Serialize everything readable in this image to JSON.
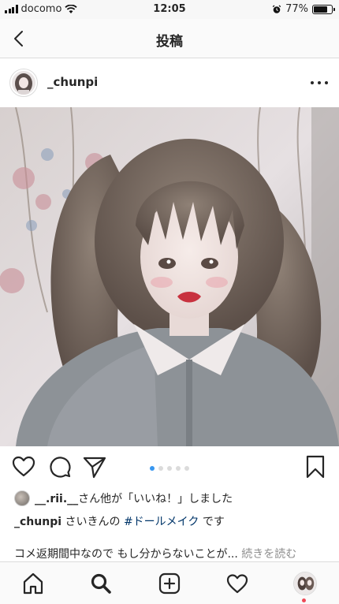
{
  "status_bar": {
    "carrier": "docomo",
    "time": "12:05",
    "battery_text": "77%",
    "battery_level": 0.77
  },
  "header": {
    "title": "投稿"
  },
  "post": {
    "username": "_chunpi",
    "carousel": {
      "count": 5,
      "active_index": 0
    },
    "likes": {
      "user": "__.rii.__",
      "suffix": "さん他が「いいね！」しました"
    },
    "caption": {
      "username": "_chunpi",
      "text_before": " さいきんの ",
      "hashtag": "#ドールメイク",
      "text_after": " です"
    },
    "comment_preview": {
      "text": "コメ返期間中なので もし分からないことが...",
      "more": "続きを読む"
    }
  },
  "tab_bar": {
    "items": [
      "home-icon",
      "search-icon",
      "add-icon",
      "heart-icon",
      "profile-avatar"
    ],
    "active": "search-icon"
  },
  "colors": {
    "accent": "#3897f0",
    "hashtag": "#003569",
    "notification": "#ed4956",
    "secondary_text": "#8e8e8e"
  }
}
